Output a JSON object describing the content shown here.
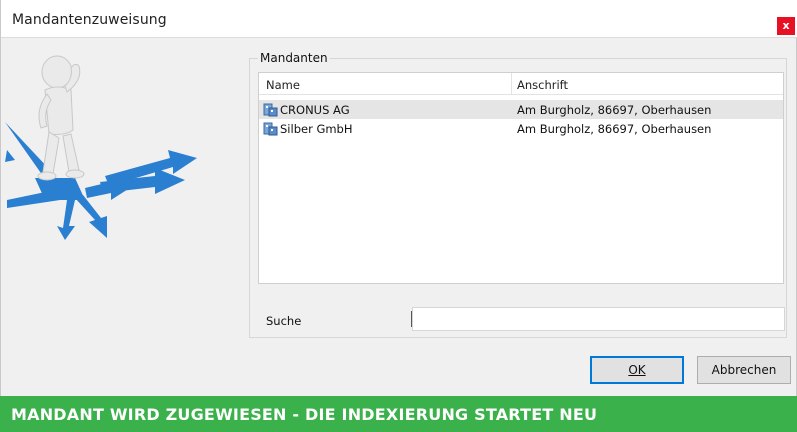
{
  "window": {
    "title": "Mandantenzuweisung",
    "close_glyph": "x"
  },
  "group": {
    "label": "Mandanten"
  },
  "list": {
    "columns": [
      "Name",
      "Anschrift"
    ],
    "rows": [
      {
        "name": "CRONUS AG",
        "address": "Am Burgholz, 86697, Oberhausen",
        "icon": "company-icon",
        "selected": true
      },
      {
        "name": "Silber GmbH",
        "address": "Am Burgholz, 86697, Oberhausen",
        "icon": "company-icon",
        "selected": false
      }
    ]
  },
  "search": {
    "label": "Suche",
    "value": ""
  },
  "buttons": {
    "ok": "OK",
    "cancel": "Abbrechen"
  },
  "banner": {
    "text": "MANDANT WIRD ZUGEWIESEN - DIE INDEXIERUNG STARTET NEU"
  },
  "colors": {
    "accent_green": "#3ab14a",
    "close_red": "#e81123",
    "arrow_blue": "#2a7fd0",
    "focus_blue": "#0078d7"
  }
}
